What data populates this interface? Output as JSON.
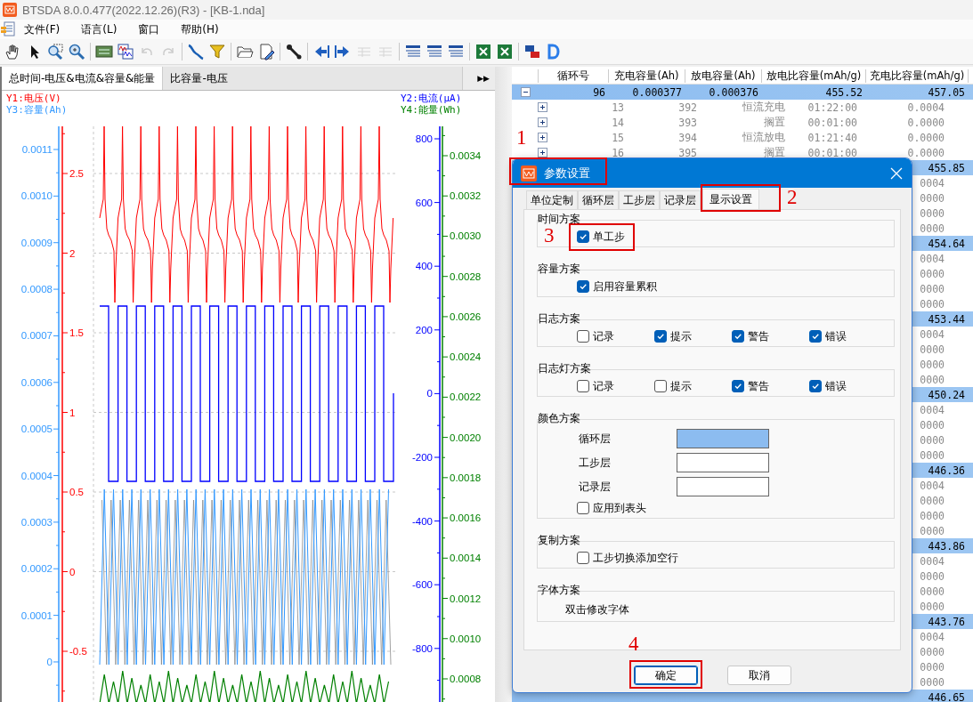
{
  "window": {
    "title": "BTSDA 8.0.0.477(2022.12.26)(R3) - [KB-1.nda]"
  },
  "menu": [
    "文件(F)",
    "语言(L)",
    "窗口",
    "帮助(H)"
  ],
  "toolbar": [
    {
      "kind": "hand",
      "disabled": false
    },
    {
      "kind": "pointer",
      "disabled": false
    },
    {
      "kind": "zoom_area",
      "disabled": false
    },
    {
      "kind": "zoom",
      "disabled": false
    },
    {
      "kind": "separator"
    },
    {
      "kind": "panel",
      "disabled": false
    },
    {
      "kind": "chart_window",
      "disabled": false
    },
    {
      "kind": "undo",
      "disabled": true
    },
    {
      "kind": "redo",
      "disabled": true
    },
    {
      "kind": "separator"
    },
    {
      "kind": "curve",
      "disabled": false
    },
    {
      "kind": "funnel",
      "disabled": false
    },
    {
      "kind": "separator"
    },
    {
      "kind": "folder",
      "disabled": false
    },
    {
      "kind": "doc_pen",
      "disabled": false
    },
    {
      "kind": "separator"
    },
    {
      "kind": "wrench",
      "disabled": false
    },
    {
      "kind": "separator"
    },
    {
      "kind": "back",
      "disabled": false
    },
    {
      "kind": "forward",
      "disabled": false
    },
    {
      "kind": "small_table",
      "disabled": true
    },
    {
      "kind": "small_table",
      "disabled": true
    },
    {
      "kind": "separator"
    },
    {
      "kind": "list",
      "disabled": false
    },
    {
      "kind": "list",
      "disabled": false
    },
    {
      "kind": "list",
      "disabled": false
    },
    {
      "kind": "separator"
    },
    {
      "kind": "sheet",
      "disabled": false
    },
    {
      "kind": "sheet",
      "disabled": false
    },
    {
      "kind": "separator"
    },
    {
      "kind": "flags",
      "disabled": false
    },
    {
      "kind": "arc",
      "disabled": false
    }
  ],
  "chart_tabs": [
    {
      "label": "总时间-电压&电流&容量&能量",
      "selected": true
    },
    {
      "label": "比容量-电压",
      "selected": false
    }
  ],
  "tab_scroll": "▶▶",
  "chart": {
    "axes": [
      {
        "kind": "y1",
        "title": "Y1:电压(V)",
        "color": "#ff0000",
        "ticks": [
          "2.5",
          "2",
          "1.5",
          "1",
          "0.5",
          "0",
          "-0.5"
        ]
      },
      {
        "kind": "y3",
        "title": "Y3:容量(Ah)",
        "color": "#3399ff",
        "ticks": [
          "0.0011",
          "0.0010",
          "0.0009",
          "0.0008",
          "0.0007",
          "0.0006",
          "0.0005",
          "0.0004",
          "0.0003",
          "0.0002",
          "0.0001",
          "0"
        ]
      },
      {
        "kind": "y2",
        "title": "Y2:电流(μA)",
        "color": "#0000ff",
        "ticks": [
          "800",
          "600",
          "400",
          "200",
          "0",
          "-200",
          "-400",
          "-600",
          "-800"
        ]
      },
      {
        "kind": "y4",
        "title": "Y4:能量(Wh)",
        "color": "#008000",
        "ticks": [
          "0.0034",
          "0.0032",
          "0.0030",
          "0.0028",
          "0.0026",
          "0.0024",
          "0.0022",
          "0.0020",
          "0.0018",
          "0.0016",
          "0.0014",
          "0.0012",
          "0.0010",
          "0.0008"
        ]
      }
    ]
  },
  "table": {
    "columns": [
      "循环号",
      "充电容量(Ah)",
      "放电容量(Ah)",
      "放电比容量(mAh/g)",
      "充电比容量(mAh/g)"
    ],
    "rows": [
      {
        "kind": "cycle",
        "expanded": true,
        "cells": [
          "96",
          "0.000377",
          "0.000376",
          "455.52",
          "457.05"
        ]
      },
      {
        "kind": "step",
        "expanded": false,
        "cells": [
          "13",
          "392",
          "恒流充电",
          "01:22:00",
          "0.0004"
        ]
      },
      {
        "kind": "step",
        "expanded": false,
        "cells": [
          "14",
          "393",
          "搁置",
          "00:01:00",
          "0.0000"
        ]
      },
      {
        "kind": "step",
        "expanded": false,
        "cells": [
          "15",
          "394",
          "恒流放电",
          "01:21:40",
          "0.0000"
        ]
      },
      {
        "kind": "step",
        "expanded": false,
        "cells": [
          "16",
          "395",
          "搁置",
          "00:01:00",
          "0.0000"
        ]
      },
      {
        "kind": "cycle_tail",
        "cells": [
          "455.85"
        ]
      },
      {
        "kind": "step_tail",
        "cells": [
          "0004"
        ]
      },
      {
        "kind": "step_tail",
        "cells": [
          "0000"
        ]
      },
      {
        "kind": "step_tail",
        "cells": [
          "0000"
        ]
      },
      {
        "kind": "step_tail",
        "cells": [
          "0000"
        ]
      },
      {
        "kind": "cycle_tail",
        "cells": [
          "454.64"
        ]
      },
      {
        "kind": "step_tail",
        "cells": [
          "0004"
        ]
      },
      {
        "kind": "step_tail",
        "cells": [
          "0000"
        ]
      },
      {
        "kind": "step_tail",
        "cells": [
          "0000"
        ]
      },
      {
        "kind": "step_tail",
        "cells": [
          "0000"
        ]
      },
      {
        "kind": "cycle_tail",
        "cells": [
          "453.44"
        ]
      },
      {
        "kind": "step_tail",
        "cells": [
          "0004"
        ]
      },
      {
        "kind": "step_tail",
        "cells": [
          "0000"
        ]
      },
      {
        "kind": "step_tail",
        "cells": [
          "0000"
        ]
      },
      {
        "kind": "step_tail",
        "cells": [
          "0000"
        ]
      },
      {
        "kind": "cycle_tail",
        "cells": [
          "450.24"
        ]
      },
      {
        "kind": "step_tail",
        "cells": [
          "0004"
        ]
      },
      {
        "kind": "step_tail",
        "cells": [
          "0000"
        ]
      },
      {
        "kind": "step_tail",
        "cells": [
          "0000"
        ]
      },
      {
        "kind": "step_tail",
        "cells": [
          "0000"
        ]
      },
      {
        "kind": "cycle_tail",
        "cells": [
          "446.36"
        ]
      },
      {
        "kind": "step_tail",
        "cells": [
          "0004"
        ]
      },
      {
        "kind": "step_tail",
        "cells": [
          "0000"
        ]
      },
      {
        "kind": "step_tail",
        "cells": [
          "0000"
        ]
      },
      {
        "kind": "step_tail",
        "cells": [
          "0000"
        ]
      },
      {
        "kind": "cycle_tail",
        "cells": [
          "443.86"
        ]
      },
      {
        "kind": "step_tail",
        "cells": [
          "0004"
        ]
      },
      {
        "kind": "step_tail",
        "cells": [
          "0000"
        ]
      },
      {
        "kind": "step_tail",
        "cells": [
          "0000"
        ]
      },
      {
        "kind": "step_tail",
        "cells": [
          "0000"
        ]
      },
      {
        "kind": "cycle_tail",
        "cells": [
          "443.76"
        ]
      },
      {
        "kind": "step_tail",
        "cells": [
          "0004"
        ]
      },
      {
        "kind": "step_tail",
        "cells": [
          "0000"
        ]
      },
      {
        "kind": "step_tail",
        "cells": [
          "0000"
        ]
      },
      {
        "kind": "step_tail",
        "cells": [
          "0000"
        ]
      },
      {
        "kind": "cycle_tail",
        "cells": [
          "446.65"
        ]
      }
    ]
  },
  "dialog": {
    "title": "参数设置",
    "tabs": [
      {
        "label": "单位定制",
        "selected": false
      },
      {
        "label": "循环层",
        "selected": false
      },
      {
        "label": "工步层",
        "selected": false
      },
      {
        "label": "记录层",
        "selected": false
      },
      {
        "label": "显示设置",
        "selected": true
      }
    ],
    "groups": [
      {
        "kind": "column",
        "title": "时间方案",
        "items": [
          {
            "kind": "checkbox",
            "label": "单工步",
            "checked": true
          }
        ]
      },
      {
        "kind": "column",
        "title": "容量方案",
        "items": [
          {
            "kind": "checkbox",
            "label": "启用容量累积",
            "checked": true
          }
        ]
      },
      {
        "kind": "row",
        "title": "日志方案",
        "items": [
          {
            "kind": "checkbox",
            "label": "记录",
            "checked": false
          },
          {
            "kind": "checkbox",
            "label": "提示",
            "checked": true
          },
          {
            "kind": "checkbox",
            "label": "警告",
            "checked": true
          },
          {
            "kind": "checkbox",
            "label": "错误",
            "checked": true
          }
        ]
      },
      {
        "kind": "row",
        "title": "日志灯方案",
        "items": [
          {
            "kind": "checkbox",
            "label": "记录",
            "checked": false
          },
          {
            "kind": "checkbox",
            "label": "提示",
            "checked": false
          },
          {
            "kind": "checkbox",
            "label": "警告",
            "checked": true
          },
          {
            "kind": "checkbox",
            "label": "错误",
            "checked": true
          }
        ]
      },
      {
        "kind": "column",
        "title": "颜色方案",
        "items": [
          {
            "kind": "color",
            "label": "循环层",
            "color": "#8cbcf0"
          },
          {
            "kind": "color",
            "label": "工步层",
            "color": "#ffffff"
          },
          {
            "kind": "color",
            "label": "记录层",
            "color": "#ffffff"
          },
          {
            "kind": "checkbox",
            "label": "应用到表头",
            "checked": false
          }
        ]
      },
      {
        "kind": "column",
        "title": "复制方案",
        "items": [
          {
            "kind": "checkbox",
            "label": "工步切换添加空行",
            "checked": false
          }
        ]
      },
      {
        "kind": "column",
        "title": "字体方案",
        "items": [
          {
            "kind": "text",
            "label": "双击修改字体"
          }
        ]
      }
    ],
    "buttons": [
      "确定",
      "取消"
    ]
  },
  "annotations": [
    "1",
    "2",
    "3",
    "4"
  ]
}
